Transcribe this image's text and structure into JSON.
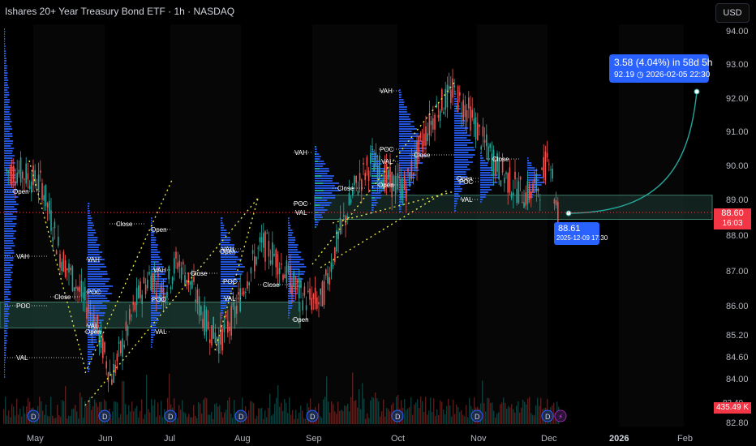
{
  "header": {
    "title": "Ishares 20+ Year Treasury Bond ETF · 1h · NASDAQ",
    "currency_button": "USD"
  },
  "measure": {
    "headline": "3.58 (4.04%) in 58d 5h",
    "target_price": "92.19",
    "target_time": "2026-02-05  22:30",
    "start_price": "88.61",
    "start_time": "2025-12-09 17:30"
  },
  "price_axis": {
    "current_price": "88.60",
    "countdown": "16:03",
    "volume_label": "435.49 K",
    "hidden_tick": "83.40"
  },
  "colors": {
    "background": "#000000",
    "candle_up": "#26a69a",
    "candle_down": "#ef5350",
    "profile_blue": "#2962ff",
    "profile_green": "#22ab94",
    "zone_fill": "#1e3d36",
    "measure_blue": "#2962ff",
    "dotted_channel": "#e6e647",
    "earnings_icon": "#2962ff",
    "split_icon": "#9c27b0"
  },
  "chart_data": {
    "type": "candlestick",
    "symbol": "Ishares 20+ Year Treasury Bond ETF",
    "interval": "1h",
    "exchange": "NASDAQ",
    "y_ticks": [
      "94.00",
      "93.00",
      "92.00",
      "91.00",
      "90.00",
      "89.00",
      "88.00",
      "87.00",
      "86.00",
      "85.20",
      "84.60",
      "84.00",
      "82.80"
    ],
    "x_ticks": [
      "May",
      "Jun",
      "Jul",
      "Aug",
      "Sep",
      "Oct",
      "Nov",
      "Dec",
      "2026",
      "Feb"
    ],
    "price_path": [
      [
        "Apr",
        89.8
      ],
      [
        "May",
        89.4
      ],
      [
        "May",
        87.4
      ],
      [
        "May",
        86.4
      ],
      [
        "May",
        85.4
      ],
      [
        "Jun",
        83.8
      ],
      [
        "Jun",
        84.9
      ],
      [
        "Jun",
        86.1
      ],
      [
        "Jun",
        86.8
      ],
      [
        "Jun",
        86.3
      ],
      [
        "Jul",
        87.2
      ],
      [
        "Jul",
        86.5
      ],
      [
        "Jul",
        85.4
      ],
      [
        "Jul",
        84.9
      ],
      [
        "Jul",
        85.6
      ],
      [
        "Aug",
        86.8
      ],
      [
        "Aug",
        87.7
      ],
      [
        "Aug",
        87.3
      ],
      [
        "Aug",
        86.6
      ],
      [
        "Aug",
        86.1
      ],
      [
        "Sep",
        86.0
      ],
      [
        "Sep",
        87.8
      ],
      [
        "Sep",
        89.3
      ],
      [
        "Sep",
        90.1
      ],
      [
        "Sep",
        89.5
      ],
      [
        "Oct",
        89.3
      ],
      [
        "Oct",
        90.6
      ],
      [
        "Oct",
        91.6
      ],
      [
        "Oct",
        92.1
      ],
      [
        "Oct",
        91.5
      ],
      [
        "Nov",
        90.6
      ],
      [
        "Nov",
        89.9
      ],
      [
        "Nov",
        89.4
      ],
      [
        "Nov",
        89.1
      ],
      [
        "Nov",
        89.4
      ],
      [
        "Dec",
        90.4
      ],
      [
        "Dec",
        89.8
      ],
      [
        "Dec",
        88.9
      ],
      [
        "Dec",
        88.61
      ]
    ],
    "annotations": {
      "labels": [
        "VAH",
        "POC",
        "VAL",
        "Open",
        "Close"
      ],
      "profiles": [
        {
          "labels": [
            "VAH",
            "POC",
            "VAL"
          ]
        },
        {
          "labels": [
            "VAH",
            "POC",
            "VAL",
            "Open",
            "Close"
          ]
        },
        {
          "labels": [
            "VAH",
            "POC",
            "VAL",
            "Open",
            "Close"
          ]
        },
        {
          "labels": [
            "VAH",
            "POC",
            "VAL",
            "Open",
            "Close"
          ]
        },
        {
          "labels": [
            "VAH",
            "POC",
            "VAL",
            "Open",
            "Close"
          ]
        },
        {
          "labels": [
            "VAH",
            "POC",
            "VAL",
            "Open",
            "Close"
          ]
        },
        {
          "labels": [
            "VAH",
            "POC",
            "VAL",
            "Open",
            "Close"
          ]
        }
      ]
    },
    "zones": [
      {
        "from": "May",
        "to": "Sep",
        "low": 85.25,
        "high": 86.0
      },
      {
        "from": "Sep",
        "to": "Dec",
        "low": 88.4,
        "high": 89.1
      }
    ],
    "measure": {
      "from": {
        "x": "2025-12-09 17:30",
        "y": 88.61
      },
      "to": {
        "x": "2026-02-05 22:30",
        "y": 92.19
      },
      "change": 3.58,
      "change_pct": 4.04,
      "duration": "58d 5h"
    },
    "current_price": 88.6,
    "volume_last": "435.49 K",
    "events": [
      "D",
      "D",
      "D",
      "D",
      "D",
      "D",
      "D",
      "D",
      "D",
      "D",
      "D"
    ],
    "grid": false
  }
}
